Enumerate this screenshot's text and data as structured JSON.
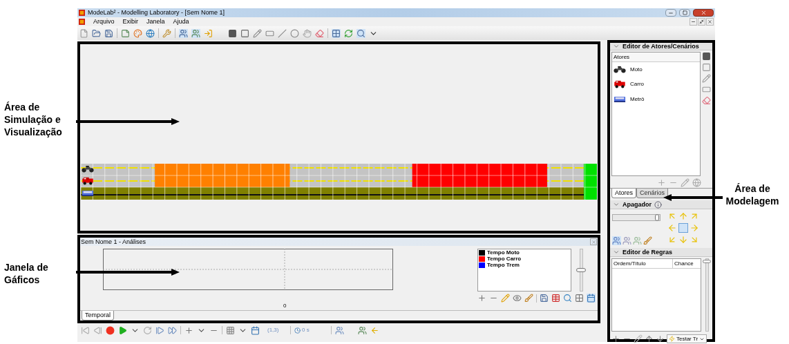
{
  "annotations": {
    "left": [
      {
        "text": "Área de Simulação e Visualização"
      },
      {
        "text": "Janela de Gáficos"
      }
    ],
    "right": [
      {
        "text": "Área de Modelagem"
      }
    ]
  },
  "window": {
    "title": "ModeLab² - Modelling Laboratory - [Sem Nome 1]"
  },
  "menu": [
    "Arquivo",
    "Exibir",
    "Janela",
    "Ajuda"
  ],
  "analysis": {
    "title": "Sem Nome 1 - Análises",
    "x_tick": "0",
    "legend": [
      {
        "label": "Tempo Moto",
        "color": "#000000"
      },
      {
        "label": "Tempo Carro",
        "color": "#ff0000"
      },
      {
        "label": "Tempo Trem",
        "color": "#0000ff"
      }
    ],
    "zoom_slider": {
      "level": 0.5
    },
    "tabs": [
      {
        "label": "Temporal",
        "selected": true
      }
    ]
  },
  "playback": {
    "position": "(1,3)",
    "time": "0 s"
  },
  "actors_editor": {
    "title": "Editor de Atores/Cenários",
    "column": "Atores",
    "actors": [
      {
        "name": "Moto",
        "kind": "moto"
      },
      {
        "name": "Carro",
        "kind": "car"
      },
      {
        "name": "Metrô",
        "kind": "train"
      }
    ],
    "tabs": [
      {
        "label": "Atores",
        "selected": true
      },
      {
        "label": "Cenários",
        "selected": false
      }
    ]
  },
  "eraser": {
    "title": "Apagador",
    "level": 0.95
  },
  "rules_editor": {
    "title": "Editor de Regras",
    "columns": [
      "Ordem/Título",
      "Chance"
    ],
    "test_button": "Testar Tr"
  }
}
